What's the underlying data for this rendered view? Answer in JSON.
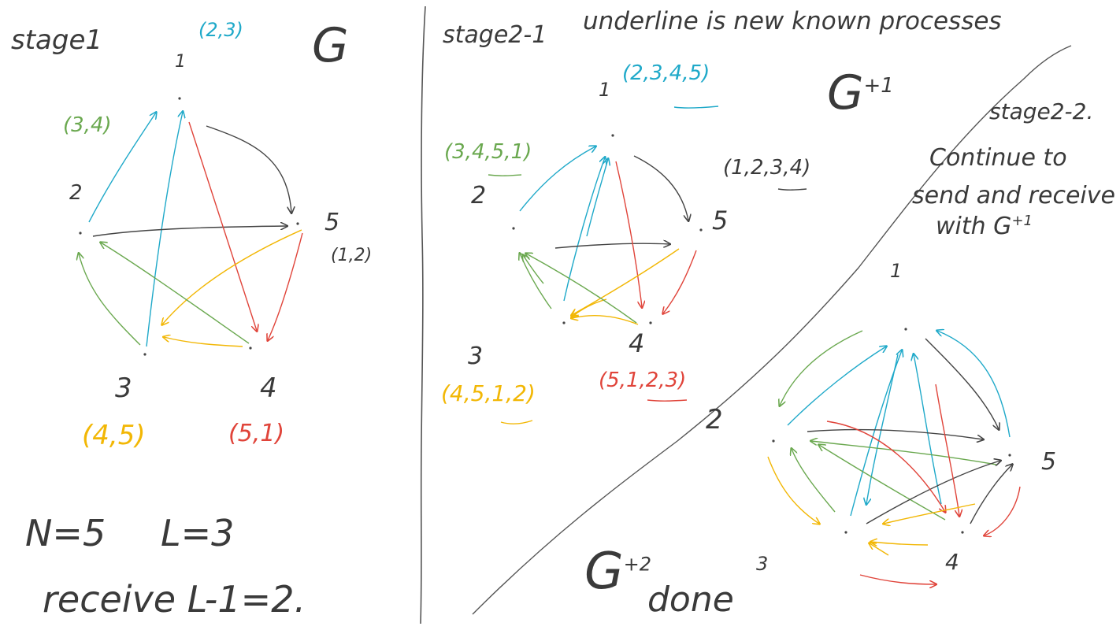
{
  "colors": {
    "ink": "#3a3a3a",
    "blue": "#1fa9c9",
    "green": "#6aa84f",
    "red": "#e0443a",
    "yellow": "#f2b705",
    "black": "#444444"
  },
  "stage1": {
    "title": "stage1",
    "graph_label": "G",
    "params_n": "N=5",
    "params_l": "L=3",
    "receive": "receive L-1=2.",
    "nodes": {
      "n1": {
        "label": "1",
        "list": "(2,3)"
      },
      "n2": {
        "label": "2",
        "list": "(3,4)"
      },
      "n3": {
        "label": "3",
        "list": "(4,5)"
      },
      "n4": {
        "label": "4",
        "list": "(5,1)"
      },
      "n5": {
        "label": "5",
        "list": "(1,2)"
      }
    }
  },
  "stage2_1": {
    "title": "stage2-1",
    "note": "underline is new known processes",
    "graph_label": "G",
    "graph_sup": "+1",
    "nodes": {
      "n1": {
        "label": "1",
        "list": "(2,3,4,5)"
      },
      "n2": {
        "label": "2",
        "list": "(3,4,5,1)"
      },
      "n3": {
        "label": "3",
        "list": "(4,5,1,2)"
      },
      "n4": {
        "label": "4",
        "list": "(5,1,2,3)"
      },
      "n5": {
        "label": "5",
        "list": "(1,2,3,4)"
      }
    }
  },
  "stage2_2": {
    "title": "stage2-2.",
    "line1": "Continue to",
    "line2": "send and receive",
    "line3": "with G",
    "line3_sup": "+1",
    "done_graph": "G",
    "done_sup": "+2",
    "done_word": "done",
    "nodes": {
      "n1": {
        "label": "1"
      },
      "n2": {
        "label": "2"
      },
      "n3": {
        "label": "3"
      },
      "n4": {
        "label": "4"
      },
      "n5": {
        "label": "5"
      }
    }
  }
}
